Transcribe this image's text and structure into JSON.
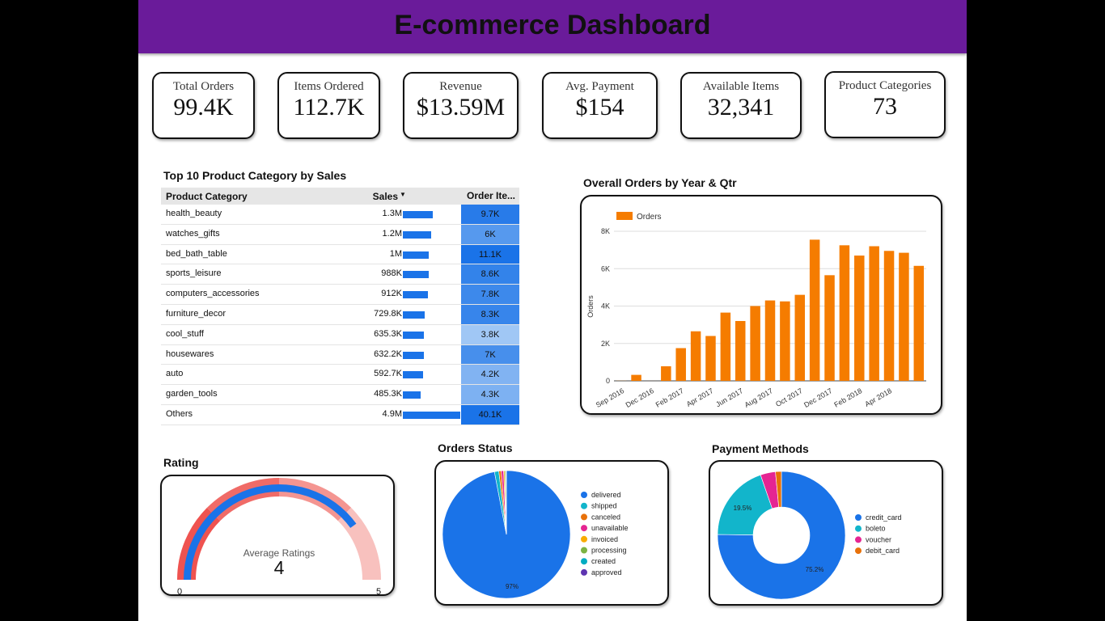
{
  "header": {
    "title": "E-commerce Dashboard"
  },
  "kpis": [
    {
      "label": "Total Orders",
      "value": "99.4K"
    },
    {
      "label": "Items Ordered",
      "value": "112.7K"
    },
    {
      "label": "Revenue",
      "value": "$13.59M"
    },
    {
      "label": "Avg. Payment",
      "value": "$154"
    },
    {
      "label": "Available Items",
      "value": "32,341"
    },
    {
      "label": "Product Categories",
      "value": "73"
    }
  ],
  "top_table": {
    "title": "Top 10 Product Category by Sales",
    "headers": {
      "category": "Product Category",
      "sales": "Sales",
      "items": "Order Ite..."
    },
    "sort_icon": "sort-desc-icon",
    "bar_color": "#1a73e8",
    "rows": [
      {
        "category": "health_beauty",
        "sales_label": "1.3M",
        "sales": 1.3,
        "items_label": "9.7K",
        "items": 9.7
      },
      {
        "category": "watches_gifts",
        "sales_label": "1.2M",
        "sales": 1.2,
        "items_label": "6K",
        "items": 6.0
      },
      {
        "category": "bed_bath_table",
        "sales_label": "1M",
        "sales": 1.0,
        "items_label": "11.1K",
        "items": 11.1
      },
      {
        "category": "sports_leisure",
        "sales_label": "988K",
        "sales": 0.988,
        "items_label": "8.6K",
        "items": 8.6
      },
      {
        "category": "computers_accessories",
        "sales_label": "912K",
        "sales": 0.912,
        "items_label": "7.8K",
        "items": 7.8
      },
      {
        "category": "furniture_decor",
        "sales_label": "729.8K",
        "sales": 0.7298,
        "items_label": "8.3K",
        "items": 8.3
      },
      {
        "category": "cool_stuff",
        "sales_label": "635.3K",
        "sales": 0.6353,
        "items_label": "3.8K",
        "items": 3.8
      },
      {
        "category": "housewares",
        "sales_label": "632.2K",
        "sales": 0.6322,
        "items_label": "7K",
        "items": 7.0
      },
      {
        "category": "auto",
        "sales_label": "592.7K",
        "sales": 0.5927,
        "items_label": "4.2K",
        "items": 4.2
      },
      {
        "category": "garden_tools",
        "sales_label": "485.3K",
        "sales": 0.4853,
        "items_label": "4.3K",
        "items": 4.3
      },
      {
        "category": "Others",
        "sales_label": "4.9M",
        "sales": 4.9,
        "items_label": "40.1K",
        "items": 40.1
      }
    ]
  },
  "chart_data": [
    {
      "type": "bar",
      "title": "Overall Orders by Year & Qtr",
      "xlabel": "",
      "ylabel": "Orders",
      "ylim": [
        0,
        8000
      ],
      "yticks": [
        "0",
        "2K",
        "4K",
        "6K",
        "8K"
      ],
      "color": "#f57c00",
      "legend": "top-left",
      "grid": true,
      "categories": [
        "Sep 2016",
        "Oct 2016",
        "Dec 2016",
        "Jan 2017",
        "Feb 2017",
        "Mar 2017",
        "Apr 2017",
        "May 2017",
        "Jun 2017",
        "Jul 2017",
        "Aug 2017",
        "Sep 2017",
        "Oct 2017",
        "Nov 2017",
        "Dec 2017",
        "Jan 2018",
        "Feb 2018",
        "Mar 2018",
        "Apr 2018",
        "May 2018",
        "Jun 2018"
      ],
      "tick_labels": [
        "Sep 2016",
        "Dec 2016",
        "Feb 2017",
        "Apr 2017",
        "Jun 2017",
        "Aug 2017",
        "Oct 2017",
        "Dec 2017",
        "Feb 2018",
        "Apr 2018"
      ],
      "series": [
        {
          "name": "Orders",
          "values": [
            5,
            320,
            1,
            780,
            1750,
            2650,
            2400,
            3650,
            3200,
            4000,
            4300,
            4250,
            4600,
            7550,
            5650,
            7250,
            6700,
            7200,
            6950,
            6850,
            6150
          ]
        }
      ]
    },
    {
      "type": "gauge",
      "title": "Rating",
      "label": "Average Ratings",
      "value": 4,
      "value_label": "4",
      "min": 0,
      "max": 5,
      "min_label": "0",
      "max_label": "5",
      "colors": {
        "bands": [
          "#ef5350",
          "#f06b67",
          "#f49591",
          "#f8c1be"
        ],
        "value": "#1a73e8"
      }
    },
    {
      "type": "pie",
      "title": "Orders Status",
      "labels": [
        "delivered",
        "shipped",
        "canceled",
        "unavailable",
        "invoiced",
        "processing",
        "created",
        "approved"
      ],
      "values": [
        97.0,
        1.1,
        0.6,
        0.6,
        0.3,
        0.3,
        0.05,
        0.05
      ],
      "pct_label": "97%",
      "colors": [
        "#1a73e8",
        "#12b5cb",
        "#e8710a",
        "#e52592",
        "#f9ab00",
        "#7cb342",
        "#00acc1",
        "#5e35b1"
      ],
      "legend": "right"
    },
    {
      "type": "pie",
      "title": "Payment Methods",
      "labels": [
        "credit_card",
        "boleto",
        "voucher",
        "debit_card"
      ],
      "values": [
        75.2,
        19.5,
        3.8,
        1.5
      ],
      "pct_labels": [
        "75.2%",
        "19.5%"
      ],
      "colors": [
        "#1a73e8",
        "#12b5cb",
        "#e52592",
        "#e8710a"
      ],
      "donut": true,
      "legend": "right"
    }
  ]
}
